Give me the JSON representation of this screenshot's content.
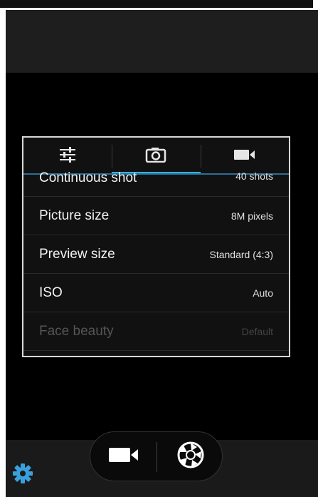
{
  "tabs": [
    {
      "icon": "sliders-icon",
      "active": false
    },
    {
      "icon": "camera-icon",
      "active": true
    },
    {
      "icon": "video-camera-icon",
      "active": false
    }
  ],
  "settings": [
    {
      "label": "Continuous shot",
      "value": "40 shots",
      "enabled": true
    },
    {
      "label": "Picture size",
      "value": "8M pixels",
      "enabled": true
    },
    {
      "label": "Preview size",
      "value": "Standard (4:3)",
      "enabled": true
    },
    {
      "label": "ISO",
      "value": "Auto",
      "enabled": true
    },
    {
      "label": "Face beauty",
      "value": "Default",
      "enabled": false
    }
  ],
  "controls": {
    "video_icon": "video-camera-icon",
    "shutter_icon": "shutter-icon",
    "settings_icon": "gear-icon"
  },
  "colors": {
    "accent": "#33b5e5",
    "settings_icon": "#3aa0dd"
  }
}
